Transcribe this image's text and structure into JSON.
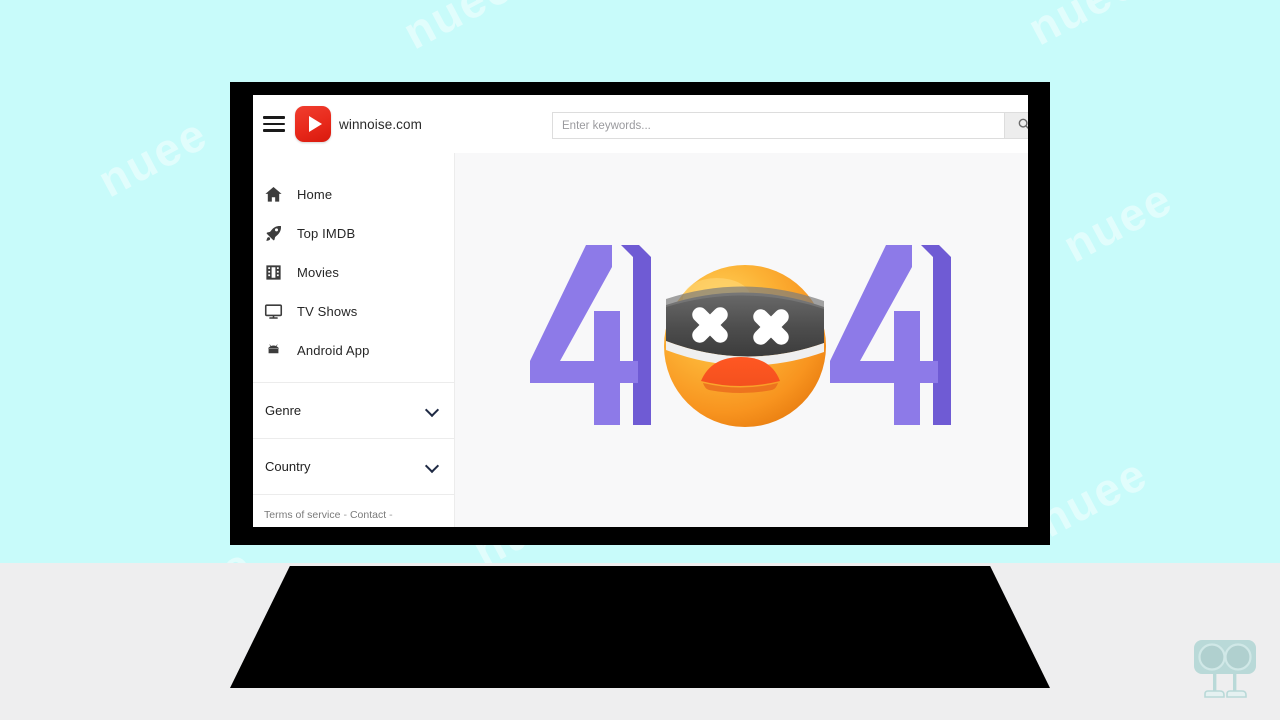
{
  "background": {
    "color": "#c8fbfa",
    "desk_color": "#eeeeef",
    "watermark_text": "nuee"
  },
  "laptop": {
    "bezel_color": "#000000",
    "screen_background": "#ffffff"
  },
  "header": {
    "menu_icon": "hamburger-icon",
    "logo_icon": "play-logo-icon",
    "brand": "winnoise.com"
  },
  "search": {
    "value": "",
    "placeholder": "Enter keywords...",
    "button_icon": "search-icon"
  },
  "sidebar": {
    "items": [
      {
        "label": "Home",
        "icon": "home-icon"
      },
      {
        "label": "Top IMDB",
        "icon": "rocket-icon"
      },
      {
        "label": "Movies",
        "icon": "film-icon"
      },
      {
        "label": "TV Shows",
        "icon": "tv-icon"
      },
      {
        "label": "Android App",
        "icon": "android-icon"
      }
    ],
    "accordions": [
      {
        "label": "Genre",
        "icon": "chevron-down-icon"
      },
      {
        "label": "Country",
        "icon": "chevron-down-icon"
      }
    ],
    "footer": {
      "terms": "Terms of service",
      "separator_1": "-",
      "contact": "Contact",
      "separator_2": "-"
    }
  },
  "main": {
    "background": "#f8f8f9",
    "error_code": "404",
    "digit_left": "4",
    "digit_right": "4",
    "digit_color": "#8d7ae8",
    "digit_shadow_color": "#6f5bd4",
    "emoji": {
      "name": "dizzy-face-with-blindfold-icon",
      "face_color": "#f9a825",
      "face_highlight": "#ffd54f",
      "band_color": "#4a4a4a",
      "eyes": "XX",
      "eye_color": "#ffffff",
      "mouth_color": "#f4511e"
    }
  },
  "watermark_logo": {
    "name": "stock-photo-watermark-icon",
    "color": "#7fb8b5"
  }
}
